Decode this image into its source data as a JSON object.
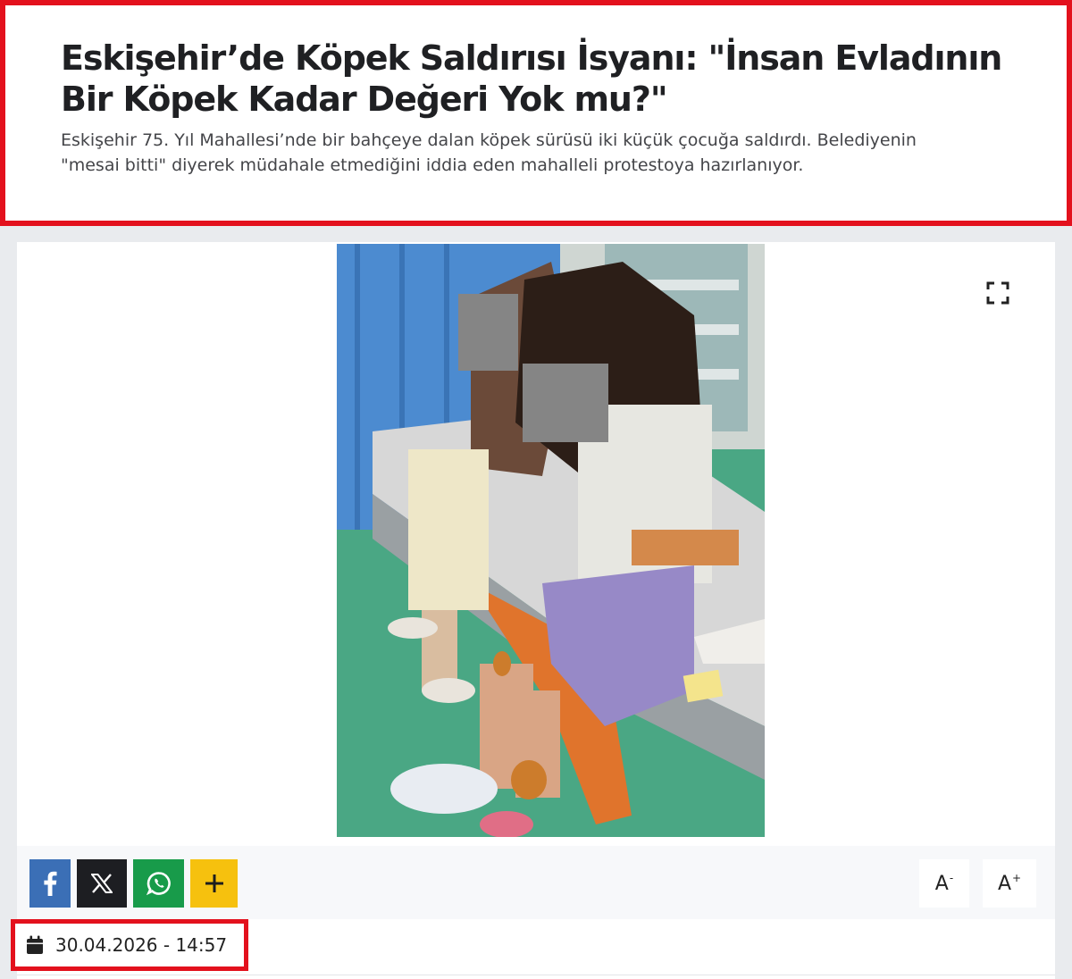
{
  "article": {
    "title": "Eskişehir’de Köpek Saldırısı İsyanı: \"İnsan Evladının Bir Köpek Kadar Değeri Yok mu?\"",
    "summary": "Eskişehir 75. Yıl Mahallesi’nde bir bahçeye dalan köpek sürüsü iki küçük çocuğa saldırdı. Belediyenin \"mesai bitti\" diyerek müdahale etmediğini iddia eden mahalleli protestoya hazırlanıyor.",
    "date": "30.04.2026 - 14:57"
  },
  "toolbar": {
    "share": [
      {
        "name": "facebook",
        "icon": "facebook-icon",
        "color": "#3b6fb6"
      },
      {
        "name": "x",
        "icon": "x-icon",
        "color": "#1d1e22"
      },
      {
        "name": "whatsapp",
        "icon": "whatsapp-icon",
        "color": "#189b4a"
      },
      {
        "name": "more",
        "icon": "plus-icon",
        "color": "#f6c10e"
      }
    ],
    "font_decrease": {
      "letter": "A",
      "sign": "-"
    },
    "font_increase": {
      "letter": "A",
      "sign": "+"
    }
  },
  "colors": {
    "highlight_border": "#e3111d",
    "page_background": "#e9ebee"
  }
}
